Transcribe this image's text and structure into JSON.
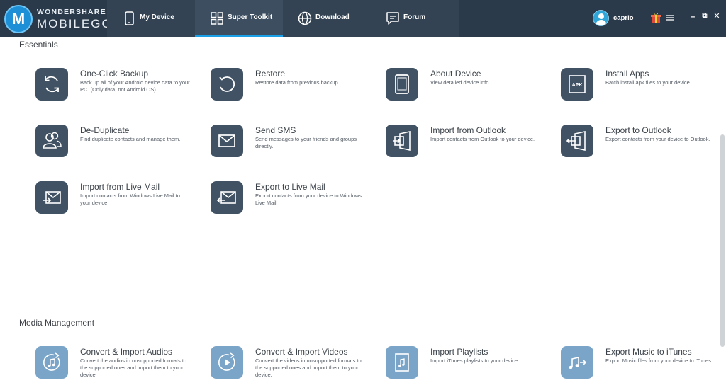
{
  "app": {
    "logo_line1": "WONDERSHARE",
    "logo_line2": "MOBILEGO",
    "logo_mark": "M"
  },
  "nav": {
    "tabs": [
      {
        "label": "My Device",
        "icon": "phone-icon"
      },
      {
        "label": "Super Toolkit",
        "icon": "grid-icon",
        "active": true
      },
      {
        "label": "Download",
        "icon": "globe-icon"
      },
      {
        "label": "Forum",
        "icon": "forum-icon"
      }
    ]
  },
  "user": {
    "name": "caprio"
  },
  "window_controls": {
    "minimize": "–",
    "restore": "⧉",
    "close": "✕"
  },
  "colors": {
    "topbar": "#2b3a4a",
    "accent": "#1aa0e6",
    "tile_dark": "#405264",
    "tile_light": "#7aa5c8"
  },
  "sections": [
    {
      "title": "Essentials",
      "items": [
        {
          "title": "One-Click Backup",
          "desc": "Back up all of your Android device data to your PC. (Only data, not Android OS)",
          "icon": "sync-icon"
        },
        {
          "title": "Restore",
          "desc": "Restore data from previous backup.",
          "icon": "restore-icon"
        },
        {
          "title": "About Device",
          "desc": "View detailed device info.",
          "icon": "tablet-icon"
        },
        {
          "title": "Install Apps",
          "desc": "Batch install apk files to your device.",
          "icon": "apk-icon",
          "badge": "APK"
        },
        {
          "title": "De-Duplicate",
          "desc": "Find duplicate contacts and manage them.",
          "icon": "contacts-icon"
        },
        {
          "title": "Send SMS",
          "desc": "Send messages to your friends and groups directly.",
          "icon": "envelope-icon"
        },
        {
          "title": "Import from Outlook",
          "desc": "Import contacts from Outlook to your device.",
          "icon": "outlook-import-icon"
        },
        {
          "title": "Export to Outlook",
          "desc": "Export contacts from your device to Outlook.",
          "icon": "outlook-export-icon"
        },
        {
          "title": "Import from Live Mail",
          "desc": "Import contacts from Windows Live Mail to your device.",
          "icon": "mail-import-icon"
        },
        {
          "title": "Export to Live Mail",
          "desc": "Export contacts from your device to Windows Live Mail.",
          "icon": "mail-export-icon"
        }
      ]
    },
    {
      "title": "Media Management",
      "items": [
        {
          "title": "Convert & Import Audios",
          "desc": "Convert the audios in unsupported formats to the supported ones and import them to your device.",
          "icon": "audio-convert-icon"
        },
        {
          "title": "Convert & Import Videos",
          "desc": "Convert the videos in unsupported formats to the supported ones and import them to your device.",
          "icon": "video-convert-icon"
        },
        {
          "title": "Import Playlists",
          "desc": "Import iTunes playlists to your device.",
          "icon": "playlist-icon"
        },
        {
          "title": "Export Music to iTunes",
          "desc": "Export Music files from your device to iTunes.",
          "icon": "music-export-icon"
        }
      ]
    }
  ]
}
